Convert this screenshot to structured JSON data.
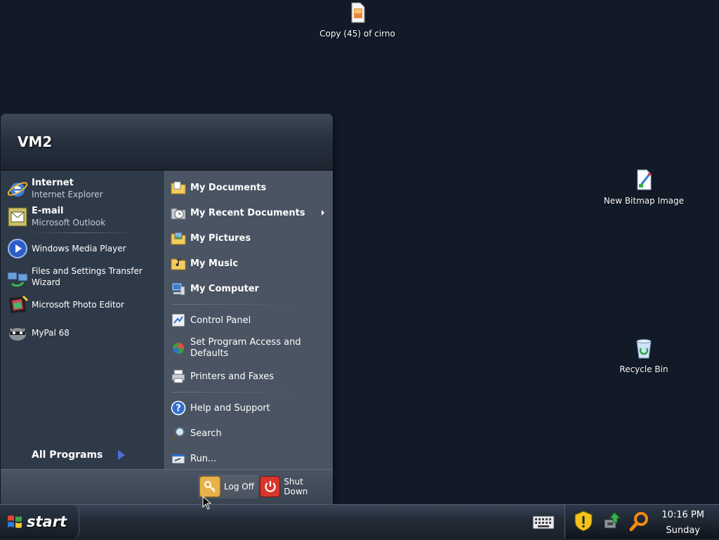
{
  "desktop": {
    "icons": [
      {
        "label": "Copy (45) of cirno"
      },
      {
        "label": "New Bitmap Image"
      },
      {
        "label": "Recycle Bin"
      }
    ]
  },
  "start_menu": {
    "user": "VM2",
    "pinned": [
      {
        "title": "Internet",
        "subtitle": "Internet Explorer"
      },
      {
        "title": "E-mail",
        "subtitle": "Microsoft Outlook"
      }
    ],
    "recent": [
      {
        "label": "Windows Media Player"
      },
      {
        "label": "Files and Settings Transfer Wizard",
        "line1": "Files and Settings Transfer",
        "line2": "Wizard"
      },
      {
        "label": "Microsoft Photo Editor"
      },
      {
        "label": "MyPal 68"
      }
    ],
    "all_programs": "All Programs",
    "right": {
      "my_documents": "My Documents",
      "my_recent_documents": "My Recent Documents",
      "my_pictures": "My Pictures",
      "my_music": "My Music",
      "my_computer": "My Computer",
      "control_panel": "Control Panel",
      "set_program_access_l1": "Set Program Access and",
      "set_program_access_l2": "Defaults",
      "printers_faxes": "Printers and Faxes",
      "help_support": "Help and Support",
      "search": "Search",
      "run": "Run..."
    },
    "footer": {
      "log_off": "Log Off",
      "shut_down": "Shut Down"
    }
  },
  "taskbar": {
    "start_label": "start",
    "clock_time": "10:16 PM",
    "clock_day": "Sunday"
  },
  "colors": {
    "desktop_bg": "#121a28",
    "menu_left": "#2f3a48",
    "menu_right": "#4a5462",
    "logoff": "#e7b24a",
    "shutdown": "#d8362d"
  }
}
